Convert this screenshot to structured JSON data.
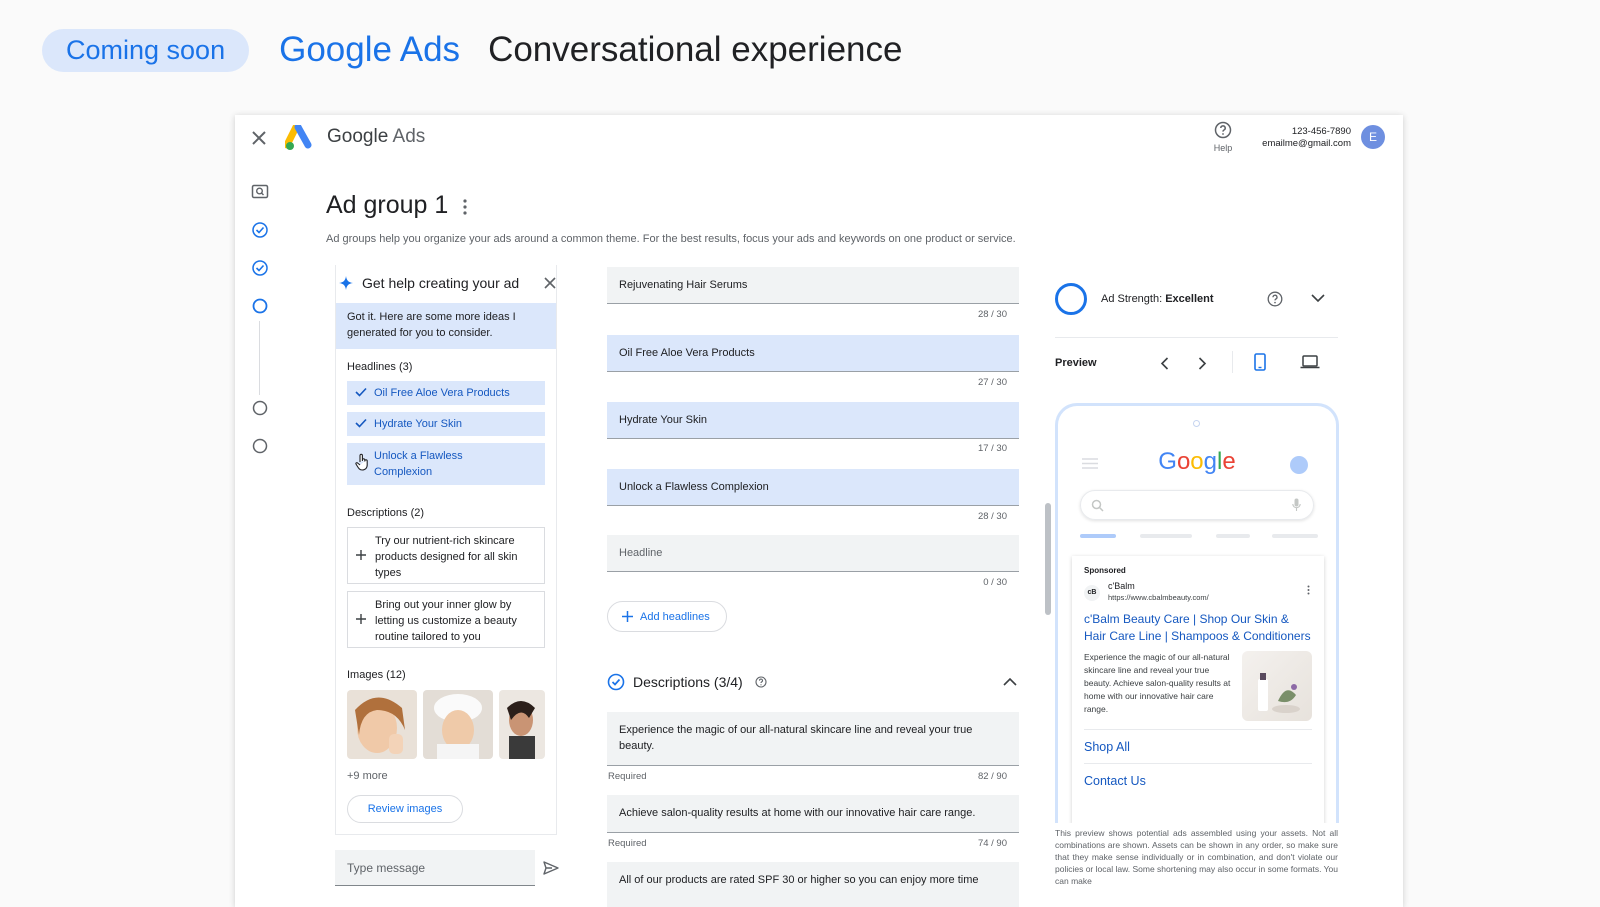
{
  "banner": {
    "pill": "Coming soon",
    "brand": "Google Ads",
    "slogan": "Conversational experience"
  },
  "topbar": {
    "logo_google": "Google",
    "logo_ads": "Ads",
    "help_label": "Help",
    "phone": "123-456-7890",
    "email": "emailme@gmail.com",
    "avatar_initial": "E"
  },
  "page": {
    "title": "Ad group 1",
    "description": "Ad groups help you organize your ads around a common theme. For the best results, focus your ads and keywords on one product or service."
  },
  "assistant": {
    "title": "Get help creating your ad",
    "message": "Got it. Here are some more ideas I generated for you to consider.",
    "headlines_title": "Headlines (3)",
    "headlines": [
      "Oil Free Aloe Vera Products",
      "Hydrate Your Skin",
      "Unlock a Flawless Complexion"
    ],
    "descriptions_title": "Descriptions (2)",
    "descriptions": [
      "Try our nutrient-rich skincare products designed for all skin types",
      "Bring out your inner glow by letting us customize a beauty routine tailored to you"
    ],
    "images_title": "Images (12)",
    "more_images": "+9 more",
    "review_button": "Review images",
    "composer_placeholder": "Type message"
  },
  "headlines": [
    {
      "text": "Rejuvenating Hair Serums",
      "count": "28 / 30",
      "state": "gray"
    },
    {
      "text": "Oil Free Aloe Vera Products",
      "count": "27 / 30",
      "state": "blue"
    },
    {
      "text": "Hydrate Your Skin",
      "count": "17 / 30",
      "state": "blue"
    },
    {
      "text": "Unlock a Flawless Complexion",
      "count": "28 / 30",
      "state": "blue"
    },
    {
      "text": "Headline",
      "count": "0 / 30",
      "state": "empty"
    }
  ],
  "add_headlines": "Add headlines",
  "descriptions_section": {
    "title": "Descriptions (3/4)",
    "items": [
      {
        "text": "Experience the magic of our all-natural skincare line and reveal your true beauty.",
        "required": "Required",
        "count": "82 / 90"
      },
      {
        "text": "Achieve salon-quality results at home with our innovative hair care range.",
        "required": "Required",
        "count": "74 / 90"
      },
      {
        "text": "All of our products are rated SPF 30 or higher so you can enjoy more time"
      }
    ]
  },
  "strength": {
    "prefix": "Ad Strength:",
    "value": "Excellent"
  },
  "preview": {
    "label": "Preview",
    "google": "Google",
    "sponsored": "Sponsored",
    "advertiser_name": "c'Balm",
    "advertiser_url": "https://www.cbalmbeauty.com/",
    "ad_headline": "c'Balm Beauty Care | Shop Our Skin & Hair Care Line | Shampoos & Conditioners",
    "ad_body": "Experience the magic of our all-natural skincare line and reveal your true beauty. Achieve salon-quality results at home with our innovative hair care range.",
    "sitelinks": [
      "Shop All",
      "Contact Us"
    ],
    "disclaimer": "This preview shows potential ads assembled using your assets. Not all combinations are shown. Assets can be shown in any order, so make sure that they make sense individually or in combination, and don't violate our policies or local law. Some shortening may also occur in some formats. You can make"
  },
  "colors": {
    "accent": "#1a73e8",
    "chip_bg": "#dbe7fb",
    "field_bg": "#f1f3f4"
  }
}
